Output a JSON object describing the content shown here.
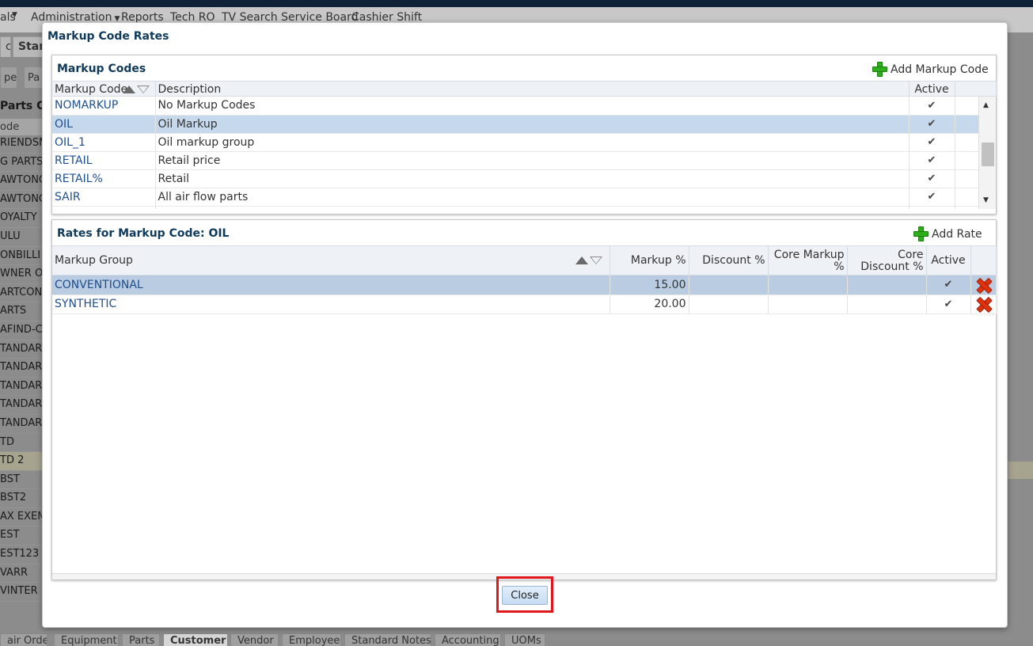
{
  "background": {
    "menu": [
      "als",
      "Administration",
      "Reports",
      "Tech RO",
      "TV Search Service Board",
      "Cashier Shift"
    ],
    "tabs": [
      "c",
      "Star"
    ],
    "subtabs": [
      "pe",
      "Pa"
    ],
    "panel_title": "Parts Co",
    "col_head": "ode",
    "rows": [
      "RIENDSM",
      "G PARTS",
      "AWTONC",
      "AWTONC",
      "OYALTY",
      "ULU",
      "ONBILLI",
      "WNER O",
      "ARTCON",
      "ARTS",
      "AFIND-C",
      "TANDARI",
      "TANDARI",
      "TANDARI",
      "TANDARI",
      "TANDARI",
      "TD",
      "TD 2",
      "BST",
      "BST2",
      "AX EXEM",
      "EST",
      "EST123",
      "VARR",
      "VINTER"
    ],
    "bottom_tabs": [
      "air Order",
      "Equipment",
      "Parts",
      "Customer",
      "Vendor",
      "Employee",
      "Standard Notes",
      "Accounting",
      "UOMs"
    ]
  },
  "dialog": {
    "title": "Markup Code Rates",
    "close_label": "Close"
  },
  "codes": {
    "title": "Markup Codes",
    "add_label": "Add Markup Code",
    "headers": {
      "code": "Markup Code",
      "description": "Description",
      "active": "Active"
    },
    "rows": [
      {
        "code": "NOMARKUP",
        "description": "No Markup Codes",
        "active": "✔"
      },
      {
        "code": "OIL",
        "description": "Oil Markup",
        "active": "✔"
      },
      {
        "code": "OIL_1",
        "description": "Oil markup group",
        "active": "✔"
      },
      {
        "code": "RETAIL",
        "description": "Retail price",
        "active": "✔"
      },
      {
        "code": "RETAIL%",
        "description": "Retail",
        "active": "✔"
      },
      {
        "code": "SAIR",
        "description": "All air flow parts",
        "active": "✔"
      }
    ]
  },
  "rates": {
    "title": "Rates for Markup Code: OIL",
    "add_label": "Add Rate",
    "headers": {
      "group": "Markup Group",
      "markup": "Markup %",
      "discount": "Discount %",
      "core_markup": "Core Markup %",
      "core_discount": "Core Discount %",
      "active": "Active"
    },
    "rows": [
      {
        "group": "CONVENTIONAL",
        "markup": "15.00",
        "discount": "",
        "core_markup": "",
        "core_discount": "",
        "active": "✔"
      },
      {
        "group": "SYNTHETIC",
        "markup": "20.00",
        "discount": "",
        "core_markup": "",
        "core_discount": "",
        "active": "✔"
      }
    ]
  },
  "colors": {
    "accent": "#0f3a5c",
    "selection": "#c6d9ec",
    "highlight": "#e0161c"
  }
}
